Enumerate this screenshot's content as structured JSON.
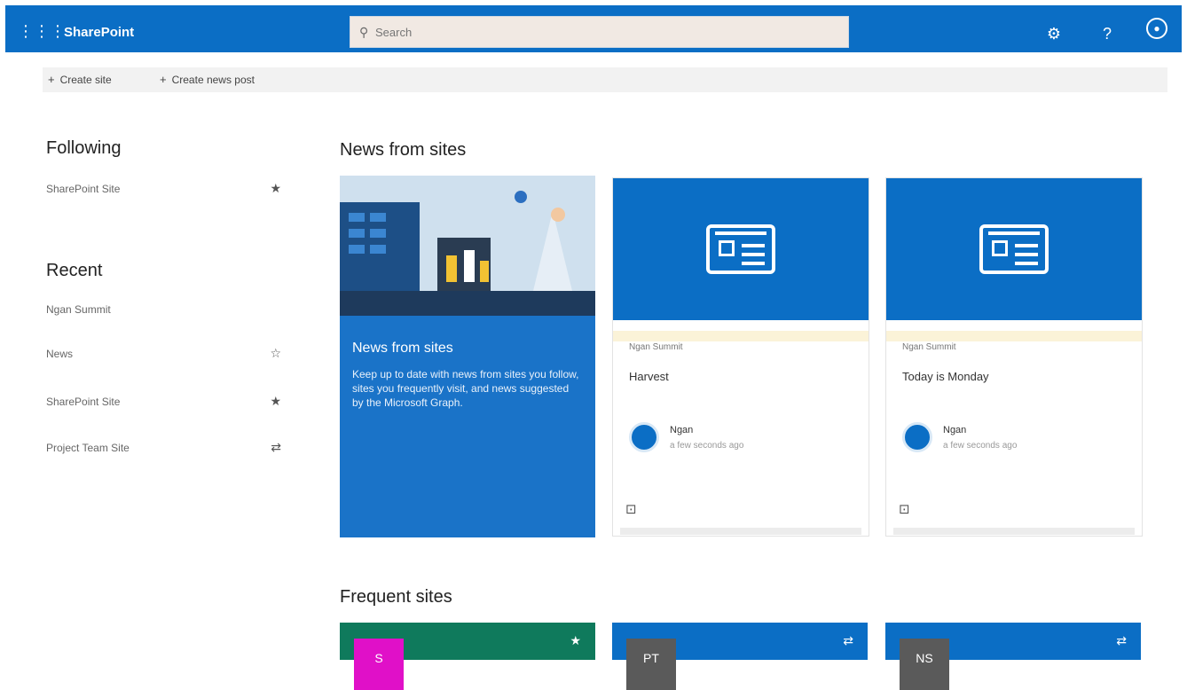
{
  "colors": {
    "brand_blue": "#0b6ec5",
    "green": "#0f7a5c",
    "magenta": "#e010c8",
    "tile_gray": "#5a5a5a"
  },
  "suitebar": {
    "app_name": "SharePoint",
    "search_placeholder": "Search",
    "waffle_icon": "waffle-icon",
    "settings_icon": "gear-icon",
    "help_icon": "help-icon",
    "help_glyph": "?",
    "profile_icon": "profile-icon"
  },
  "commandbar": {
    "create_site": "Create site",
    "create_news_post": "Create news post"
  },
  "following": {
    "title": "Following",
    "items": [
      {
        "label": "SharePoint Site",
        "icon": "star-filled-icon"
      }
    ]
  },
  "recent": {
    "title": "Recent",
    "items": [
      {
        "label": "Ngan Summit",
        "icon": ""
      },
      {
        "label": "News",
        "icon": "star-outline-icon"
      },
      {
        "label": "SharePoint Site",
        "icon": "star-filled-icon"
      },
      {
        "label": "Project Team Site",
        "icon": "share-icon"
      }
    ]
  },
  "news": {
    "title": "News from sites",
    "hero": {
      "title": "News from sites",
      "description": "Keep up to date with news from sites you follow, sites you frequently visit, and news suggested by the Microsoft Graph."
    },
    "cards": [
      {
        "site": "Ngan Summit",
        "headline": "Harvest",
        "author": "Ngan",
        "time": "a few seconds ago"
      },
      {
        "site": "Ngan Summit",
        "headline": "Today is Monday",
        "author": "Ngan",
        "time": "a few seconds ago"
      }
    ]
  },
  "frequent": {
    "title": "Frequent sites",
    "tiles": [
      {
        "color": "#0f7a5c",
        "tile_color": "#e010c8",
        "abbr": "S"
      },
      {
        "color": "#0b6ec5",
        "tile_color": "#5a5a5a",
        "abbr": "PT"
      },
      {
        "color": "#0b6ec5",
        "tile_color": "#5a5a5a",
        "abbr": "NS"
      }
    ]
  }
}
